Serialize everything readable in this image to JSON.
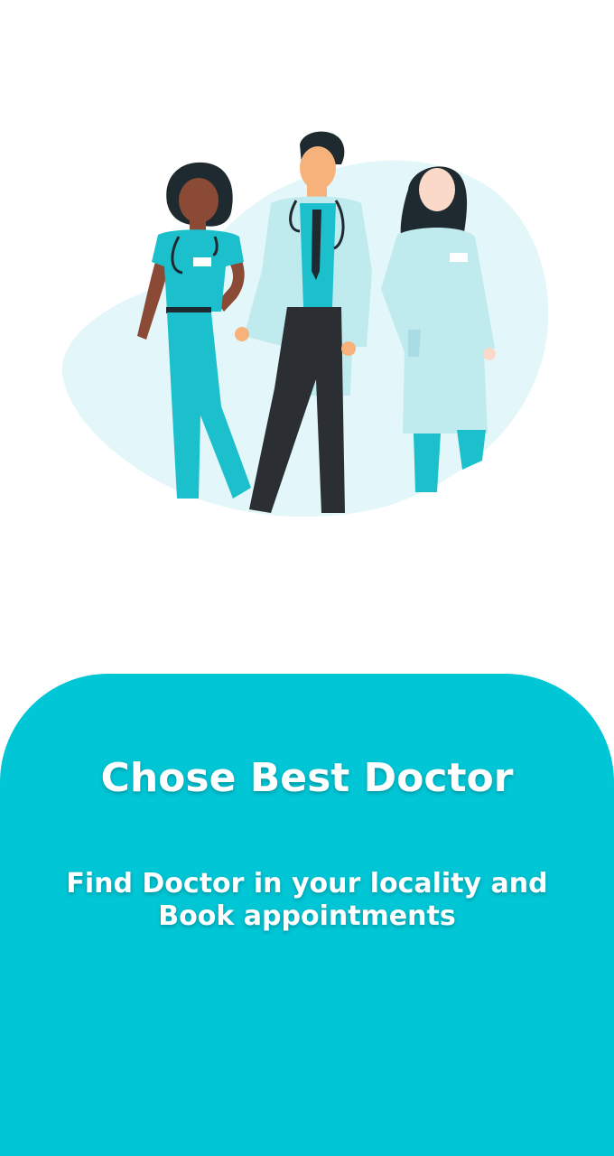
{
  "onboarding": {
    "title": "Chose Best Doctor",
    "subtitle": "Find Doctor in your locality and Book appointments"
  },
  "colors": {
    "accent": "#00c6d5",
    "background": "#ffffff",
    "blob": "#e3f6f9",
    "scrubs": "#1cc0cc",
    "coat": "#bfeaee",
    "pants_dark": "#2b2f33"
  },
  "illustration": {
    "icon": "doctors-group-illustration"
  }
}
